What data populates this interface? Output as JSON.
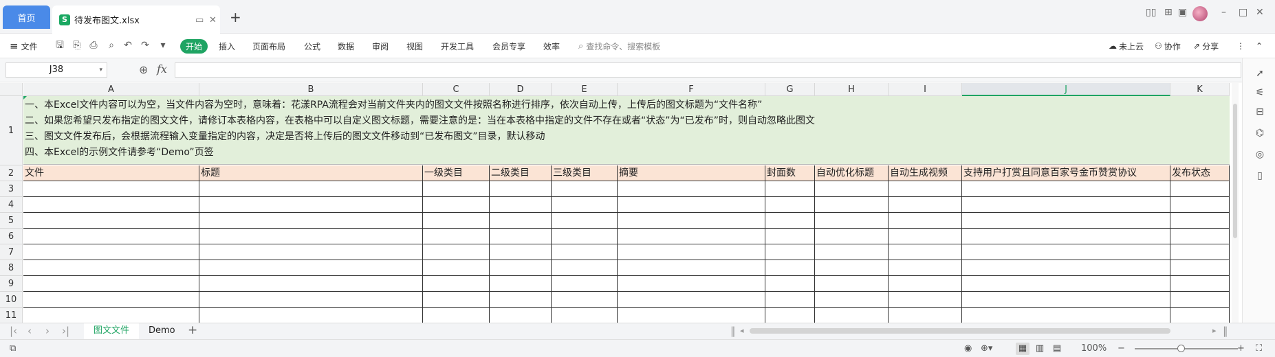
{
  "titlebar": {
    "home_tab": "首页",
    "file_tab": "待发布图文.xlsx",
    "new_tab": "+"
  },
  "ribbon": {
    "file_menu": "文件",
    "start": "开始",
    "tabs": [
      "插入",
      "页面布局",
      "公式",
      "数据",
      "审阅",
      "视图",
      "开发工具",
      "会员专享",
      "效率"
    ],
    "search_placeholder": "查找命令、搜索模板",
    "cloud": "未上云",
    "collab": "协作",
    "share": "分享"
  },
  "formula_bar": {
    "cell_ref": "J38",
    "fx": "fx",
    "value": ""
  },
  "grid": {
    "columns": [
      {
        "letter": "A"
      },
      {
        "letter": "B"
      },
      {
        "letter": "C"
      },
      {
        "letter": "D"
      },
      {
        "letter": "E"
      },
      {
        "letter": "F"
      },
      {
        "letter": "G"
      },
      {
        "letter": "H"
      },
      {
        "letter": "I"
      },
      {
        "letter": "J"
      },
      {
        "letter": "K"
      }
    ],
    "active_column": "J",
    "row_numbers": [
      "1",
      "2",
      "3",
      "4",
      "5",
      "6",
      "7",
      "8",
      "9",
      "10",
      "11"
    ],
    "notes": [
      "一、本Excel文件内容可以为空，当文件内容为空时，意味着：花漾RPA流程会对当前文件夹内的图文文件按照名称进行排序，依次自动上传，上传后的图文标题为“文件名称”",
      "二、如果您希望只发布指定的图文文件，请修订本表格内容，在表格中可以自定义图文标题，需要注意的是：当在本表格中指定的文件不存在或者“状态”为“已发布”时，则自动忽略此图文",
      "三、图文文件发布后，会根据流程输入变量指定的内容，决定是否将上传后的图文文件移动到“已发布图文”目录，默认移动",
      "四、本Excel的示例文件请参考“Demo”页签"
    ],
    "headers": [
      "文件",
      "标题",
      "一级类目",
      "二级类目",
      "三级类目",
      "摘要",
      "封面数",
      "自动优化标题",
      "自动生成视频",
      "支持用户打赏且同意百家号金币赞赏协议",
      "发布状态"
    ]
  },
  "sheets": {
    "tabs": [
      "图文文件",
      "Demo"
    ],
    "active": "图文文件",
    "add": "+"
  },
  "statusbar": {
    "zoom": "100%",
    "minus": "−",
    "plus": "+"
  }
}
